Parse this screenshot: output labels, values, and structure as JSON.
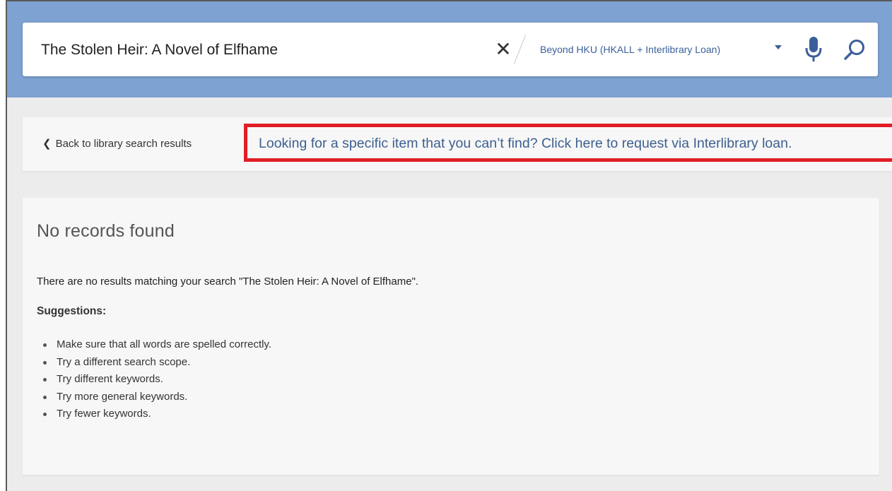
{
  "search": {
    "query": "The Stolen Heir: A Novel of Elfhame",
    "scope": "Beyond HKU (HKALL + Interlibrary Loan)",
    "clear_icon": "close-icon",
    "mic_icon": "microphone-icon",
    "search_icon": "search-icon"
  },
  "nav": {
    "back_label": "Back to library search results",
    "ill_link": "Looking for a specific item that you can’t find? Click here to request via Interlibrary loan."
  },
  "results": {
    "heading": "No records found",
    "message": "There are no results matching your search \"The Stolen Heir: A Novel of Elfhame\".",
    "suggestions_label": "Suggestions:",
    "suggestions": [
      "Make sure that all words are spelled correctly.",
      "Try a different search scope.",
      "Try different keywords.",
      "Try more general keywords.",
      "Try fewer keywords."
    ]
  },
  "colors": {
    "header_band": "#7ea2d2",
    "highlight_box": "#e01e24",
    "link": "#3d5f8f",
    "scope_text": "#3b5f9b"
  }
}
